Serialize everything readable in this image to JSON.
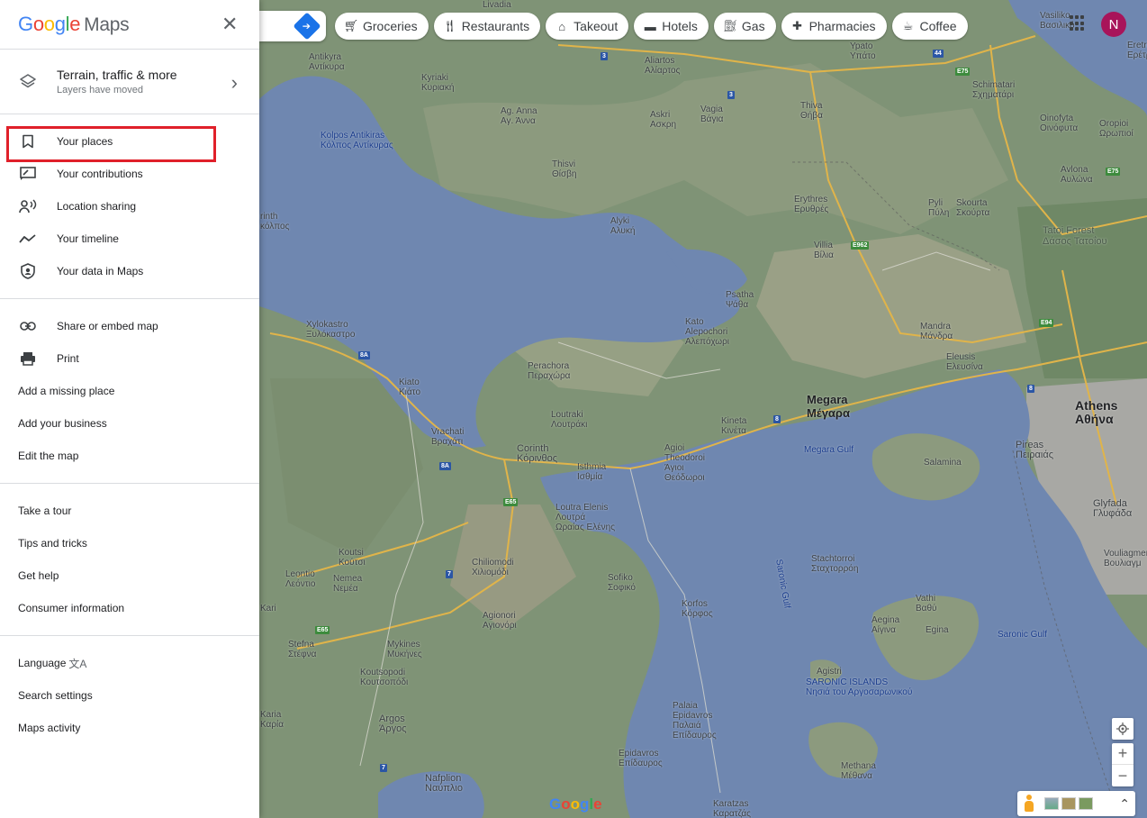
{
  "panel": {
    "logo": {
      "google": [
        "G",
        "o",
        "o",
        "g",
        "l",
        "e"
      ],
      "maps": "Maps"
    },
    "layers": {
      "title": "Terrain, traffic & more",
      "subtitle": "Layers have moved"
    },
    "section1": [
      {
        "label": "Your places",
        "icon": "bookmark-icon"
      },
      {
        "label": "Your contributions",
        "icon": "contributions-icon"
      },
      {
        "label": "Location sharing",
        "icon": "location-sharing-icon"
      },
      {
        "label": "Your timeline",
        "icon": "timeline-icon"
      },
      {
        "label": "Your data in Maps",
        "icon": "shield-icon"
      }
    ],
    "section2": [
      {
        "label": "Share or embed map",
        "icon": "link-icon"
      },
      {
        "label": "Print",
        "icon": "print-icon"
      },
      {
        "label": "Add a missing place"
      },
      {
        "label": "Add your business"
      },
      {
        "label": "Edit the map"
      }
    ],
    "section3": [
      {
        "label": "Take a tour"
      },
      {
        "label": "Tips and tricks"
      },
      {
        "label": "Get help"
      },
      {
        "label": "Consumer information"
      }
    ],
    "section4": [
      {
        "label": "Language"
      },
      {
        "label": "Search settings"
      },
      {
        "label": "Maps activity"
      }
    ]
  },
  "chips": [
    "Groceries",
    "Restaurants",
    "Takeout",
    "Hotels",
    "Gas",
    "Pharmacies",
    "Coffee"
  ],
  "avatar_letter": "N",
  "map_footer": {
    "zoom_in": "+",
    "zoom_out": "−",
    "logo": "Google"
  },
  "map_labels": {
    "places": [
      "Livadia",
      "Antikyra\nΑντίκυρα",
      "Kyriaki\nΚυριακή",
      "Aliartos\nΑλίαρτος",
      "Ag. Anna\nΑγ. Άννα",
      "Askri\nΑσκρη",
      "Vagia\nΒάγια",
      "Thiva\nΘήβα",
      "Ypato\nΥπάτο",
      "Schimatari\nΣχηματάρι",
      "Oinofyta\nΟινόφυτα",
      "Oropioi\nΩρωπιοί",
      "Vasiliko\nΒασιλικό",
      "Eretria\nΕρέτρ",
      "Kolpos Antikiras\nΚόλπος Αντίκυρας",
      "Thisvi\nΘίσβη",
      "Alyki\nΑλυκή",
      "Erythres\nΕρυθρές",
      "Pyli\nΠύλη",
      "Skourta\nΣκούρτα",
      "Avlona\nΑυλώνα",
      "Tatoi Forest\nΔάσος Τατοΐου",
      "Villia\nΒίλια",
      "Psatha\nΨάθα",
      "Kato\nAlepochori\nΑλεπόχωρι",
      "Mandra\nΜάνδρα",
      "Eleusis\nΕλευσίνα",
      "Xylokastro\nΞυλόκαστρο",
      "Perachora\nΠεραχώρα",
      "Kiato\nΚιάτο",
      "Loutraki\nΛουτράκι",
      "Vrachati\nΒραχάτι",
      "Corinth\nΚόρινθος",
      "Isthmia\nΙσθμία",
      "Agioi\nTheodoroi\nΆγιοι\nΘεόδωροι",
      "Kineta\nΚινέτα",
      "Salamina",
      "Pireas\nΠειραιάς",
      "Glyfada\nΓλυφάδα",
      "Vouliagmeni\nΒουλιαγμ",
      "Loutra Elenis\nΛουτρά\nΩραίας Ελένης",
      "Koutsi\nΚούτσι",
      "Nemea\nΝεμέα",
      "Leontio\nΛεόντιο",
      "Chiliomodi\nΧιλιομόδι",
      "Sofiko\nΣοφικό",
      "Korfos\nΚόρφος",
      "Stachtorroi\nΣταχτορρόη",
      "Vathi\nΒαθύ",
      "Aegina\nΑίγινα",
      "Egina",
      "Agionori\nΑγιονόρι",
      "Stefna\nΣτέφνα",
      "Mykines\nΜυκήνες",
      "Koutsopodi\nΚουτσοπόδι",
      "Argos\nΆργος",
      "Palaia\nEpidavros\nΠαλαιά\nΕπίδαυρος",
      "Epidavros\nΕπίδαυρος",
      "Agistri",
      "Methana\nΜέθανα",
      "Nafplion\nΝαύπλιο",
      "Karatzas\nΚαρατζάς",
      "rinth\nκόλπος",
      "Karia\nΚαρία",
      "Kari"
    ],
    "cities": [
      "Megara\nΜέγαρα",
      "Athens\nΑθήνα"
    ],
    "water": [
      "Megara Gulf",
      "Saronic Gulf",
      "Saronic Gulf",
      "SARONIC ISLANDS\nΝησιά του Αργοσαρωνικού"
    ]
  }
}
